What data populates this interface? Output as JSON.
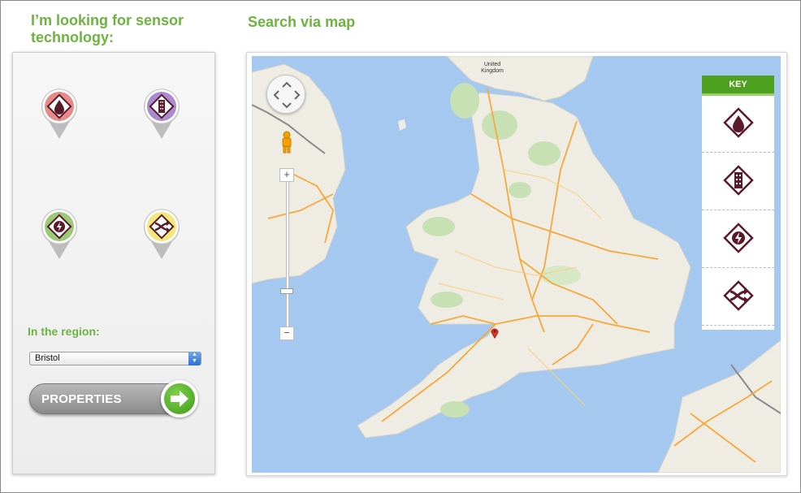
{
  "sidebar": {
    "heading": "I’m looking for sensor technology:",
    "pins": [
      {
        "icon": "water-drop-icon",
        "color": "#e57373"
      },
      {
        "icon": "building-icon",
        "color": "#9b7bc4"
      },
      {
        "icon": "energy-icon",
        "color": "#8fc06a"
      },
      {
        "icon": "transport-icon",
        "color": "#f0e26a"
      }
    ],
    "region_label": "In the region:",
    "region_select": {
      "value": "Bristol"
    },
    "properties_button": "PROPERTIES"
  },
  "map_section": {
    "heading": "Search via map",
    "labels": {
      "united_kingdom": "United Kingdom"
    },
    "zoom": {
      "in": "+",
      "out": "−"
    },
    "key": {
      "title": "KEY",
      "items": [
        "water-drop-icon",
        "building-icon",
        "energy-icon",
        "transport-icon"
      ]
    }
  },
  "colors": {
    "brand_green": "#6cb33f",
    "key_icon": "#5a1a2a",
    "sea": "#a4c8f0",
    "land": "#f1eee6",
    "road": "#f6a93a"
  }
}
